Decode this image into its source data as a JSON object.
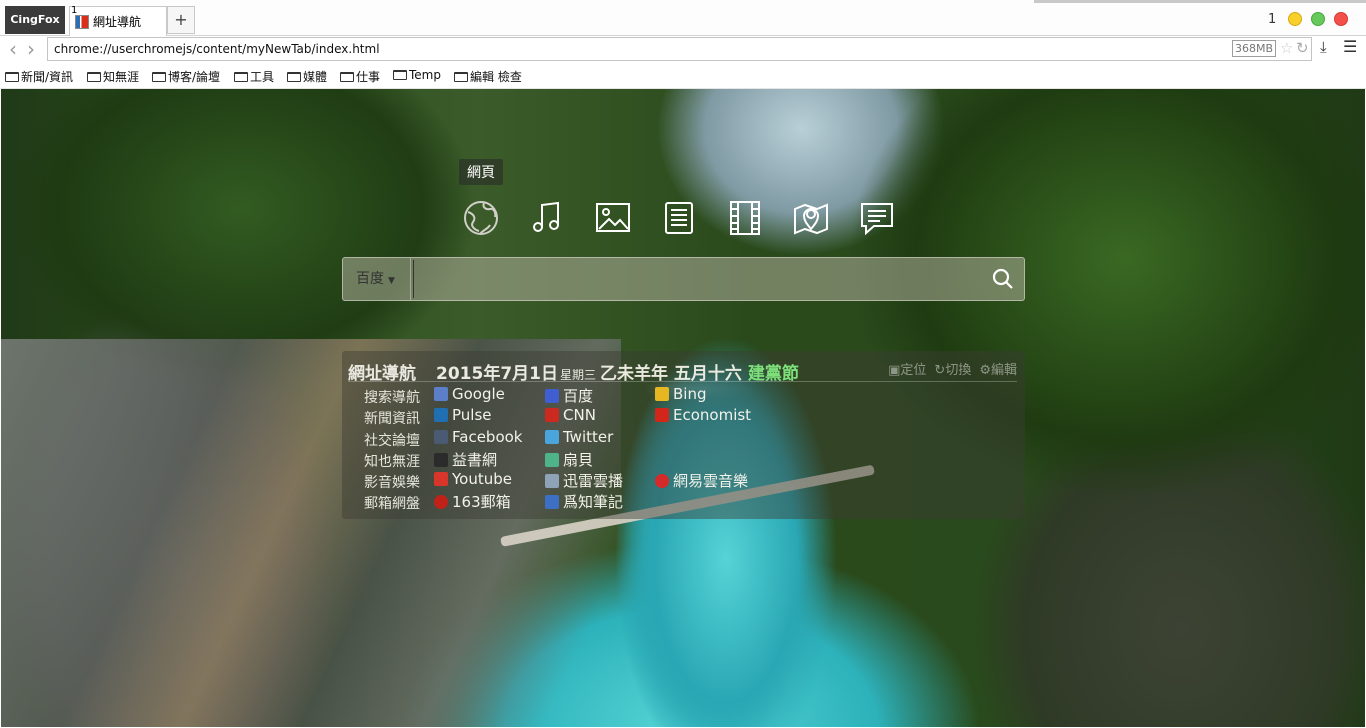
{
  "browser": {
    "app_menu": "CingFox",
    "tab": {
      "index": "1",
      "title": "網址導航"
    },
    "new_tab": "+",
    "tab_count": "1",
    "url": "chrome://userchromejs/content/myNewTab/index.html",
    "memory": "368MB"
  },
  "bookmarks": [
    "新聞/資訊",
    "知無涯",
    "博客/論壇",
    "工具",
    "媒體",
    "仕事",
    "Temp",
    "編輯 檢查"
  ],
  "search": {
    "tooltip": "網頁",
    "categories": [
      "globe-icon",
      "music-icon",
      "image-icon",
      "document-icon",
      "video-icon",
      "map-icon",
      "chat-icon"
    ],
    "engine": "百度",
    "query": ""
  },
  "panel": {
    "title": "網址導航",
    "date": "2015年7月1日",
    "weekday": "星期三",
    "lunar": "乙未羊年 五月十六",
    "festival": "建黨節",
    "tools": [
      "定位",
      "切換",
      "編輯"
    ],
    "rows": [
      {
        "label": "搜索導航",
        "links": [
          "Google",
          "百度",
          "Bing"
        ]
      },
      {
        "label": "新聞資訊",
        "links": [
          "Pulse",
          "CNN",
          "Economist"
        ]
      },
      {
        "label": "社交論壇",
        "links": [
          "Facebook",
          "Twitter"
        ]
      },
      {
        "label": "知也無涯",
        "links": [
          "益書網",
          "扇貝"
        ]
      },
      {
        "label": "影音娛樂",
        "links": [
          "Youtube",
          "迅雷雲播",
          "網易雲音樂"
        ]
      },
      {
        "label": "郵箱網盤",
        "links": [
          "163郵箱",
          "爲知筆記"
        ]
      }
    ]
  },
  "colors": {
    "festival": "#7ee07a",
    "accent_dark": "#3b3b3b"
  }
}
